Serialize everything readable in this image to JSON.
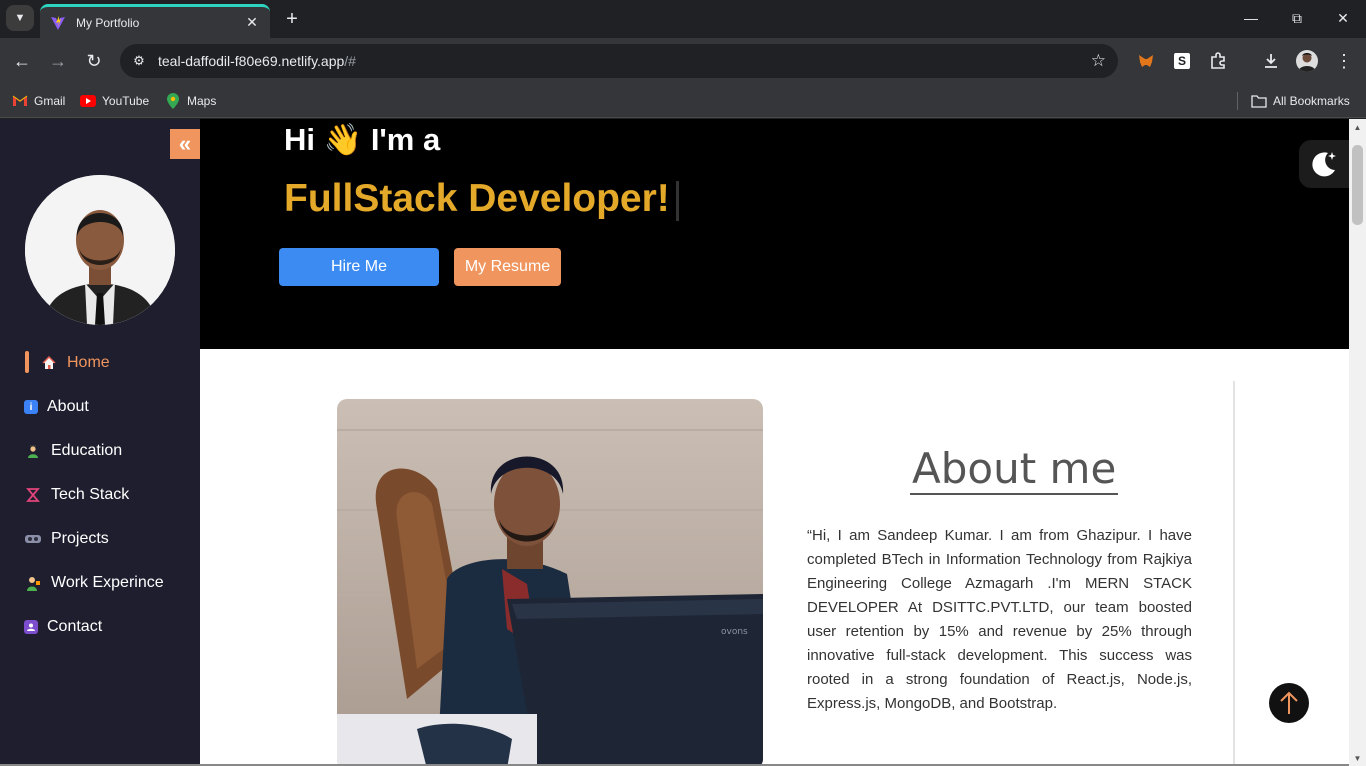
{
  "browser": {
    "tab_title": "My Portfolio",
    "url_main": "teal-daffodil-f80e69.netlify.app",
    "url_suffix": "/#",
    "bookmarks": [
      {
        "label": "Gmail",
        "icon": "gmail-icon"
      },
      {
        "label": "YouTube",
        "icon": "youtube-icon"
      },
      {
        "label": "Maps",
        "icon": "maps-icon"
      }
    ],
    "all_bookmarks": "All Bookmarks"
  },
  "sidebar": {
    "items": [
      {
        "label": "Home",
        "icon": "home-icon",
        "active": true
      },
      {
        "label": "About",
        "icon": "info-icon"
      },
      {
        "label": "Education",
        "icon": "student-icon"
      },
      {
        "label": "Tech Stack",
        "icon": "hourglass-icon"
      },
      {
        "label": "Projects",
        "icon": "vr-headset-icon"
      },
      {
        "label": "Work Experince",
        "icon": "worker-icon"
      },
      {
        "label": "Contact",
        "icon": "contact-card-icon"
      }
    ]
  },
  "hero": {
    "greeting": "Hi 👋 I'm a",
    "role": "FullStack Developer!",
    "hire_label": "Hire Me",
    "resume_label": "My Resume"
  },
  "about": {
    "title": "About me",
    "text": "“Hi, I am Sandeep Kumar. I am from Ghazipur. I have completed BTech in Information Technology from Rajkiya Engineering College Azmagarh .I'm MERN STACK DEVELOPER At DSITTC.PVT.LTD, our team boosted user retention by 15% and revenue by 25% through innovative full-stack development. This success was rooted in a strong foundation of React.js, Node.js, Express.js, MongoDB, and Bootstrap."
  },
  "colors": {
    "accent_orange": "#f0955e",
    "accent_gold": "#e5a92a",
    "hire_blue": "#3b8bf2",
    "sidebar_bg": "#1e1e2f"
  }
}
